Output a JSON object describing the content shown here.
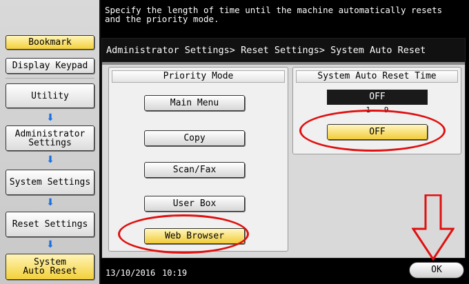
{
  "message": "Specify the length of time until the machine automatically resets\nand the priority mode.",
  "left_nav": {
    "bookmark": "Bookmark",
    "display_keypad": "Display Keypad",
    "utility": "Utility",
    "administrator_settings": "Administrator\nSettings",
    "system_settings": "System Settings",
    "reset_settings": "Reset Settings",
    "system_auto_reset": "System\nAuto Reset",
    "arrow_glyph": "⬇"
  },
  "breadcrumb": "Administrator Settings> Reset Settings> System Auto Reset",
  "priority_mode": {
    "header": "Priority Mode",
    "options": [
      "Main Menu",
      "Copy",
      "Scan/Fax",
      "User Box",
      "Web Browser"
    ],
    "selected": "Web Browser"
  },
  "auto_reset_time": {
    "header": "System Auto Reset Time",
    "display_value": "OFF",
    "range_text": "1 - 9",
    "button_label": "OFF"
  },
  "footer": {
    "date": "13/10/2016",
    "time": "10:19",
    "ok_label": "OK"
  },
  "colors": {
    "selected_yellow": "#f2cc3a",
    "annotation_red": "#e01010",
    "nav_arrow_blue": "#1a6fe0"
  }
}
